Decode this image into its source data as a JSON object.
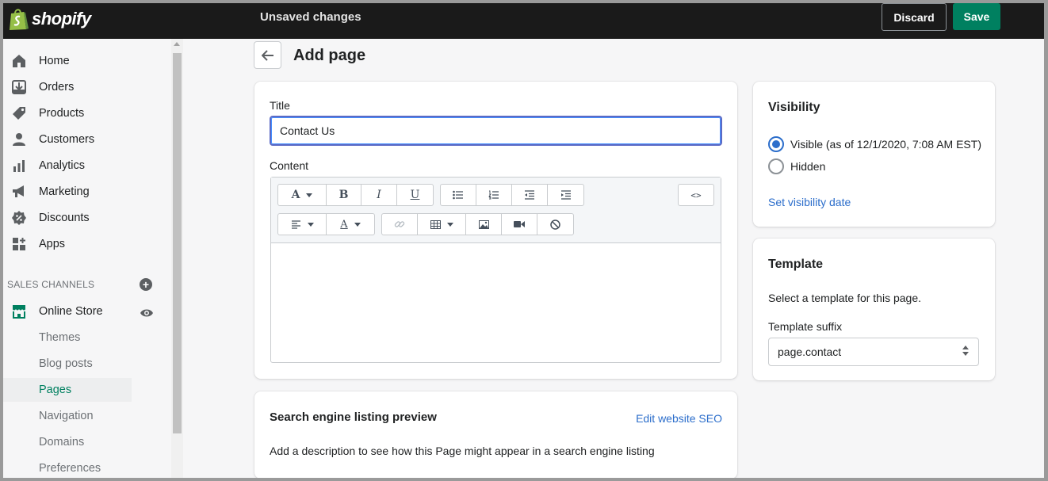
{
  "topbar": {
    "brand": "shopify",
    "status": "Unsaved changes",
    "discard_label": "Discard",
    "save_label": "Save"
  },
  "sidebar": {
    "items": [
      {
        "label": "Home",
        "icon": "home-icon"
      },
      {
        "label": "Orders",
        "icon": "orders-icon"
      },
      {
        "label": "Products",
        "icon": "tag-icon"
      },
      {
        "label": "Customers",
        "icon": "person-icon"
      },
      {
        "label": "Analytics",
        "icon": "bar-chart-icon"
      },
      {
        "label": "Marketing",
        "icon": "megaphone-icon"
      },
      {
        "label": "Discounts",
        "icon": "discount-icon"
      },
      {
        "label": "Apps",
        "icon": "apps-icon"
      }
    ],
    "sales_channels_heading": "SALES CHANNELS",
    "online_store_label": "Online Store",
    "sub_items": [
      "Themes",
      "Blog posts",
      "Pages",
      "Navigation",
      "Domains",
      "Preferences"
    ],
    "active_sub_item": "Pages",
    "accent_color": "#008060"
  },
  "page": {
    "title": "Add page"
  },
  "main_card": {
    "title_label": "Title",
    "title_value": "Contact Us",
    "content_label": "Content",
    "html_toggle_label": "<>"
  },
  "seo_card": {
    "heading": "Search engine listing preview",
    "edit_link": "Edit website SEO",
    "description": "Add a description to see how this Page might appear in a search engine listing"
  },
  "visibility_card": {
    "heading": "Visibility",
    "options": [
      {
        "label": "Visible (as of 12/1/2020, 7:08 AM EST)",
        "checked": true
      },
      {
        "label": "Hidden",
        "checked": false
      }
    ],
    "set_date_link": "Set visibility date"
  },
  "template_card": {
    "heading": "Template",
    "description": "Select a template for this page.",
    "suffix_label": "Template suffix",
    "suffix_value": "page.contact"
  }
}
